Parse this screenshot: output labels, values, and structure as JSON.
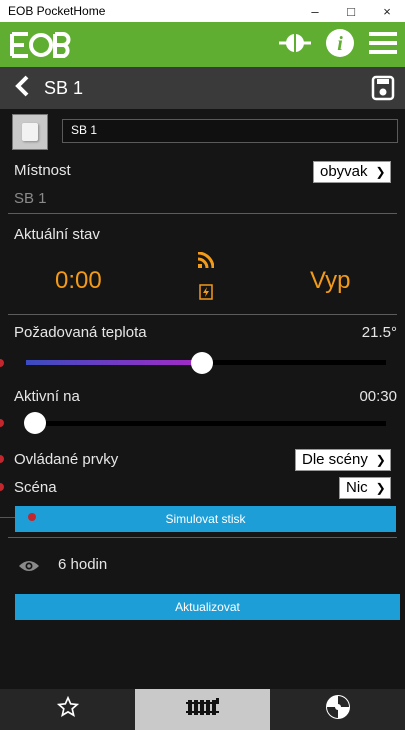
{
  "window": {
    "title": "EOB PocketHome",
    "min_glyph": "–",
    "max_glyph": "□",
    "close_glyph": "×"
  },
  "header": {
    "title": "SB 1"
  },
  "device": {
    "name_value": "SB 1",
    "room_label": "Místnost",
    "room_value": "obyvak",
    "device_sub": "SB 1"
  },
  "status": {
    "label": "Aktuální stav",
    "time": "0:00",
    "state": "Vyp"
  },
  "temp": {
    "label": "Požadovaná teplota",
    "value": "21.5°",
    "fraction": 0.49
  },
  "active": {
    "label": "Aktivní na",
    "value": "00:30",
    "fraction": 0.0
  },
  "controlled": {
    "label": "Ovládané prvky",
    "value": "Dle scény"
  },
  "scene": {
    "label": "Scéna",
    "value": "Nic"
  },
  "buttons": {
    "simulate": "Simulovat stisk",
    "update": "Aktualizovat"
  },
  "history": {
    "value": "6 hodin"
  },
  "colors": {
    "green": "#5fae31",
    "accent": "#1e9ed7",
    "orange": "#f29a1a",
    "slider_gradient_start": "#3b4cc0",
    "slider_gradient_end": "#a52ac5"
  }
}
